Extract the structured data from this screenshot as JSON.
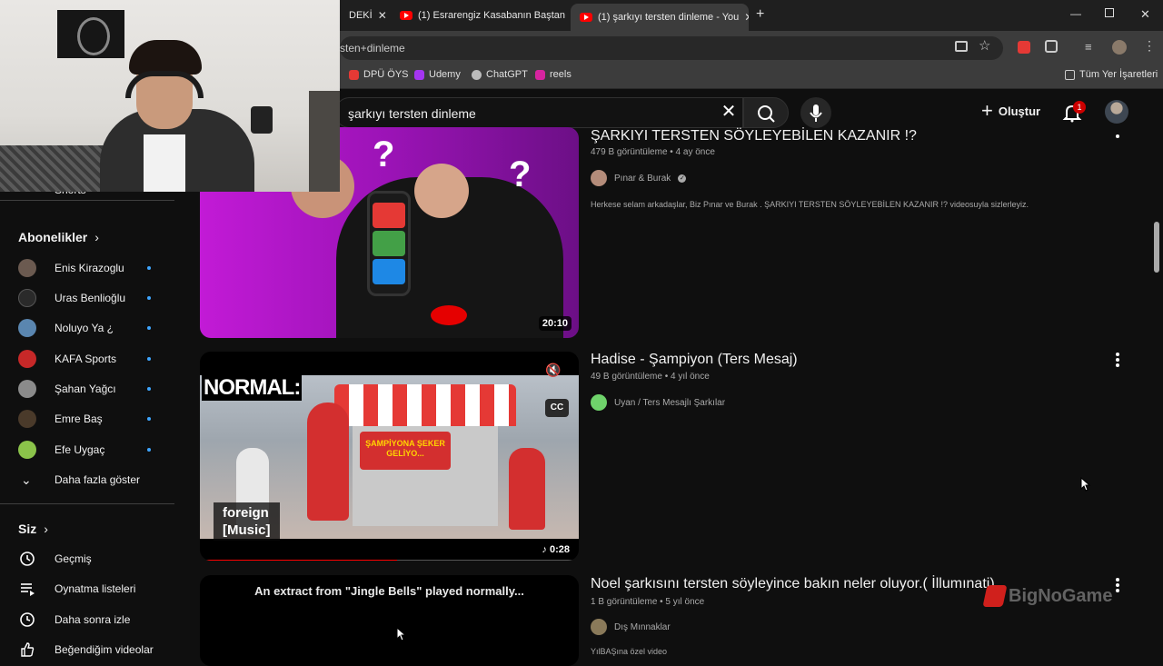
{
  "browser": {
    "tabs": [
      {
        "label": "DEKİ",
        "active": false
      },
      {
        "label": "(1) Esrarengiz Kasabanın Baştan",
        "active": false
      },
      {
        "label": "(1) şarkıyı tersten dinleme - You",
        "active": true
      }
    ],
    "new_tab": "+",
    "url_fragment": "sten+dinleme",
    "bookmarks": [
      {
        "label": "DPÜ ÖYS",
        "color": "#e53935"
      },
      {
        "label": "Udemy",
        "color": "#a435f0"
      },
      {
        "label": "ChatGPT",
        "color": "#bbbbbb"
      },
      {
        "label": "reels",
        "color": "#d6249f"
      }
    ],
    "bookmarks_all": "Tüm Yer İşaretleri"
  },
  "yt_header": {
    "search_value": "şarkıyı tersten dinleme",
    "create_label": "Oluştur",
    "notification_count": "1"
  },
  "sidebar": {
    "partial_item": "Shorts",
    "subscriptions_heading": "Abonelikler",
    "subscriptions": [
      {
        "label": "Enis Kirazoglu",
        "color": "#6b5a50"
      },
      {
        "label": "Uras Benlioğlu",
        "color": "#2a2a2a"
      },
      {
        "label": "Noluyo Ya ¿",
        "color": "#5a86b0"
      },
      {
        "label": "KAFA Sports",
        "color": "#c62828"
      },
      {
        "label": "Şahan Yağcı",
        "color": "#8b8b8b"
      },
      {
        "label": "Emre Baş",
        "color": "#4a3a2a"
      },
      {
        "label": "Efe Uygaç",
        "color": "#8bc34a"
      }
    ],
    "show_more": "Daha fazla göster",
    "you_heading": "Siz",
    "you_items": [
      {
        "label": "Geçmiş",
        "icon": "history-icon"
      },
      {
        "label": "Oynatma listeleri",
        "icon": "playlists-icon"
      },
      {
        "label": "Daha sonra izle",
        "icon": "clock-icon"
      },
      {
        "label": "Beğendiğim videolar",
        "icon": "thumbs-up-icon"
      }
    ]
  },
  "results": [
    {
      "title": "ŞARKIYI TERSTEN SÖYLEYEBİLEN KAZANIR !?",
      "meta": "479 B görüntüleme • 4 ay önce",
      "channel": "Pınar & Burak",
      "verified": true,
      "description": "Herkese selam arkadaşlar, Biz Pınar ve Burak . ŞARKIYI TERSTEN SÖYLEYEBİLEN KAZANIR !? videosuyla sizlerleyiz.",
      "duration": "20:10"
    },
    {
      "title": "Hadise - Şampiyon (Ters Mesaj)",
      "meta": "49 B görüntüleme • 4 yıl önce",
      "channel": "Uyan / Ters Mesajlı Şarkılar",
      "duration": "0:28",
      "thumb_caption": "NORMAL:",
      "sign_text": "ŞAMPİYONA ŞEKER GELİYO...",
      "subtitle_line1": "foreign",
      "subtitle_line2": "[Music]",
      "cc_label": "CC",
      "progress": 0.52
    },
    {
      "title": "Noel şarkısını tersten söyleyince bakın neler oluyor.( İllumınati)",
      "meta": "1 B görüntüleme • 5 yıl önce",
      "channel": "Dış Mınnaklar",
      "description": "YılBAŞına özel video",
      "thumb_text": "An extract from \"Jingle Bells\" played normally..."
    }
  ],
  "watermark": "BigNoGame"
}
